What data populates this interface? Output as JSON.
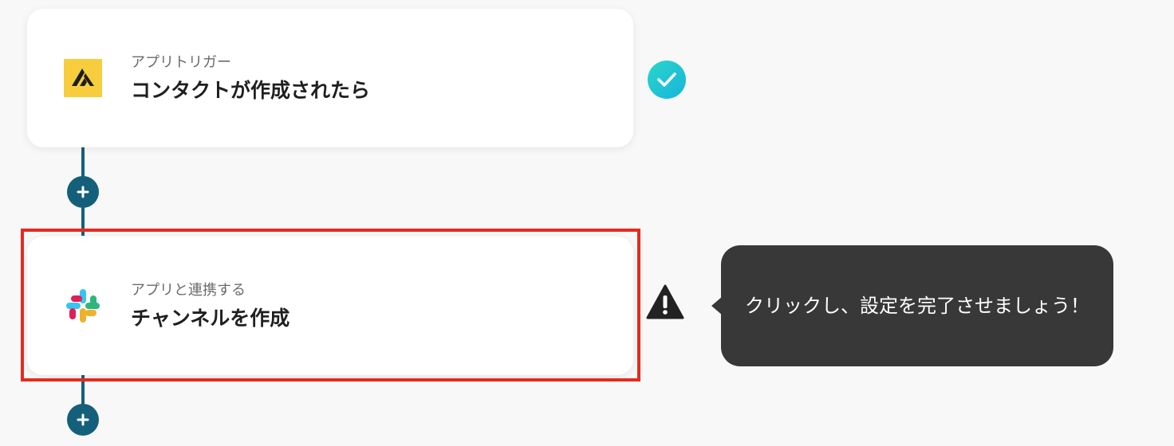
{
  "flow": {
    "steps": [
      {
        "subtitle": "アプリトリガー",
        "title": "コンタクトが作成されたら",
        "icon": "attio-logo-icon",
        "status": "complete",
        "status_icon": "check-circle-icon",
        "status_color": "#1ec8d8"
      },
      {
        "subtitle": "アプリと連携する",
        "title": "チャンネルを作成",
        "icon": "slack-logo-icon",
        "status": "incomplete",
        "status_icon": "warning-triangle-icon",
        "status_color": "#222222"
      }
    ],
    "connector_color": "#14607a",
    "add_button_icon": "plus-icon"
  },
  "tooltip": {
    "text": "クリックし、設定を完了させましょう！"
  },
  "highlight_color": "#e62a1f"
}
